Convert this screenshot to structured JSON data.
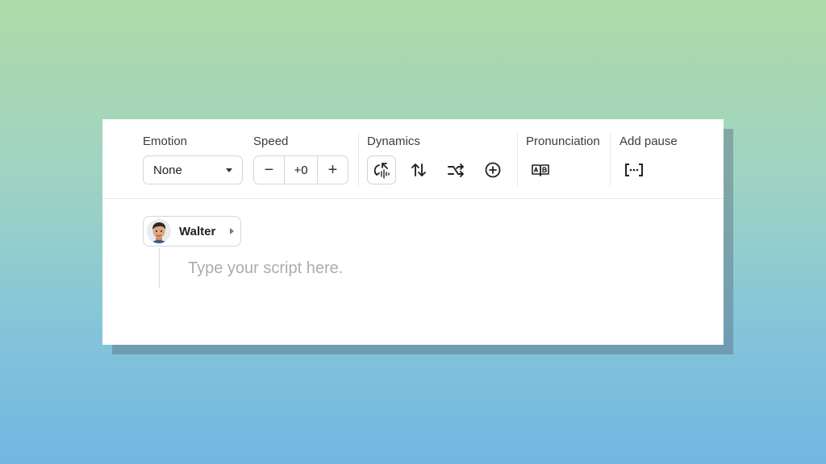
{
  "toolbar": {
    "emotion": {
      "label": "Emotion",
      "value": "None"
    },
    "speed": {
      "label": "Speed",
      "value": "+0",
      "decrement": "−",
      "increment": "+"
    },
    "dynamics": {
      "label": "Dynamics",
      "icons": [
        "voice-dynamics-icon",
        "swap-updown-icon",
        "shuffle-icon",
        "add-circle-icon"
      ]
    },
    "pronunciation": {
      "label": "Pronunciation",
      "icon": "open-book-ab-icon"
    },
    "pause": {
      "label": "Add pause",
      "icon": "bracket-dots-icon"
    }
  },
  "editor": {
    "speaker": {
      "name": "Walter"
    },
    "placeholder": "Type your script here."
  }
}
